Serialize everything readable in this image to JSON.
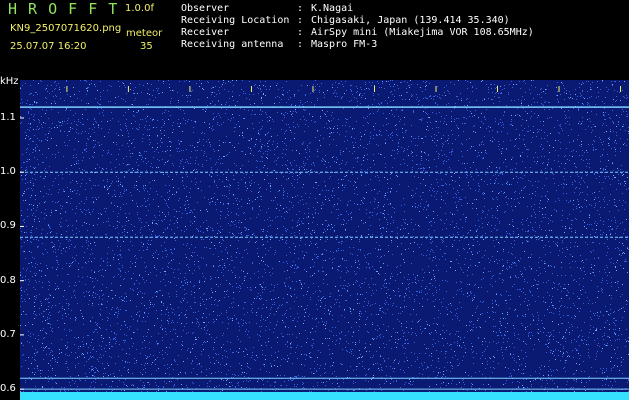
{
  "header": {
    "logo": "H R O F F T",
    "version": "1.0.0f",
    "filename": "KN9_2507071620.png",
    "meteor_label": "meteor",
    "datetime": "25.07.07 16:20",
    "meteor_count": "35",
    "info": [
      {
        "label": "Observer",
        "value": "K.Nagai"
      },
      {
        "label": "Receiving Location",
        "value": "Chigasaki, Japan (139.414 35.340)"
      },
      {
        "label": "Receiver",
        "value": "AirSpy mini (Miakejima VOR 108.65MHz)"
      },
      {
        "label": "Receiving antenna",
        "value": "Maspro FM-3"
      }
    ]
  },
  "colors": {
    "background": "#000000",
    "plot_bg": "#0a1a73",
    "noise": "#3c6ef0",
    "line": "#7fd0ff",
    "text_green": "#8fe35f",
    "text_yellow": "#f2ef6a",
    "bottom_bar": "#36e0ff"
  },
  "chart_data": {
    "type": "heatmap",
    "ylabel": "kHz",
    "x_ticks": [
      "1621",
      "1622",
      "1623",
      "1624",
      "1625",
      "1626",
      "1627",
      "1628",
      "1629",
      "1630"
    ],
    "x_range": [
      1620.4,
      1630.3
    ],
    "y_ticks": [
      "1.1",
      "1.0",
      "0.9",
      "0.8",
      "0.7",
      "0.6"
    ],
    "y_range": [
      0.58,
      1.17
    ],
    "horizontal_lines_khz": [
      1.12,
      1.0,
      0.88,
      0.62,
      0.6
    ]
  }
}
